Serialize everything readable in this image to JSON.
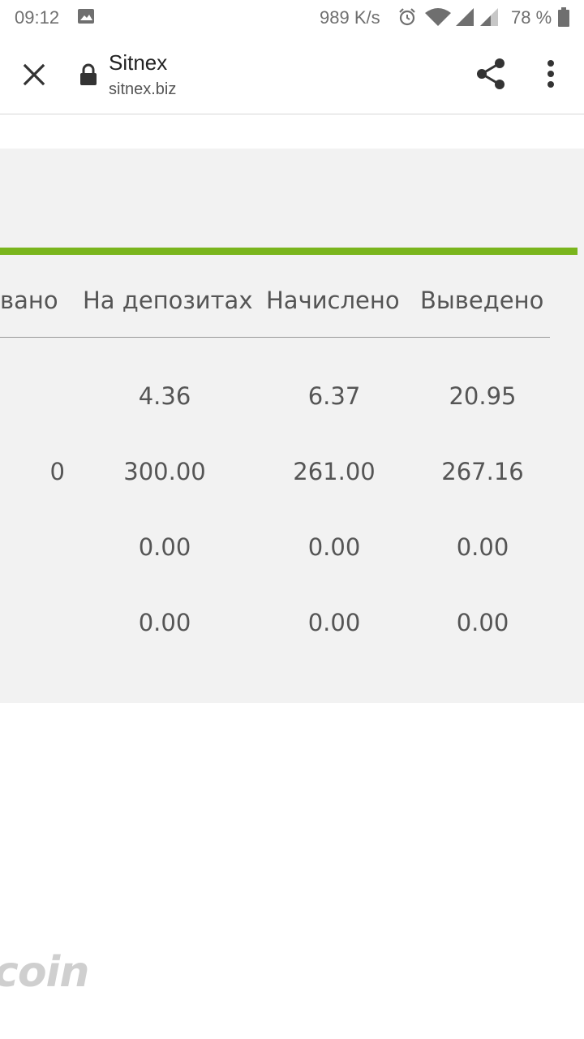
{
  "status_bar": {
    "time": "09:12",
    "network_speed": "989 K/s",
    "battery": "78 %",
    "icons": [
      "image-icon",
      "alarm-icon",
      "wifi-icon",
      "signal-icon",
      "signal-icon",
      "battery-icon"
    ]
  },
  "toolbar": {
    "title": "Sitnex",
    "url": "sitnex.biz",
    "icons": [
      "close-icon",
      "lock-icon",
      "share-icon",
      "more-vert-icon"
    ]
  },
  "table": {
    "accent_color": "#7ab51d",
    "headers": [
      "вано",
      "На депозитах",
      "Начислено",
      "Выведено"
    ],
    "rows": [
      {
        "first": "",
        "deposits": "4.36",
        "accrued": "6.37",
        "withdrawn": "20.95"
      },
      {
        "first": "0",
        "deposits": "300.00",
        "accrued": "261.00",
        "withdrawn": "267.16"
      },
      {
        "first": "",
        "deposits": "0.00",
        "accrued": "0.00",
        "withdrawn": "0.00"
      },
      {
        "first": "",
        "deposits": "0.00",
        "accrued": "0.00",
        "withdrawn": "0.00"
      }
    ]
  },
  "footer": {
    "logo_text": "coin"
  }
}
